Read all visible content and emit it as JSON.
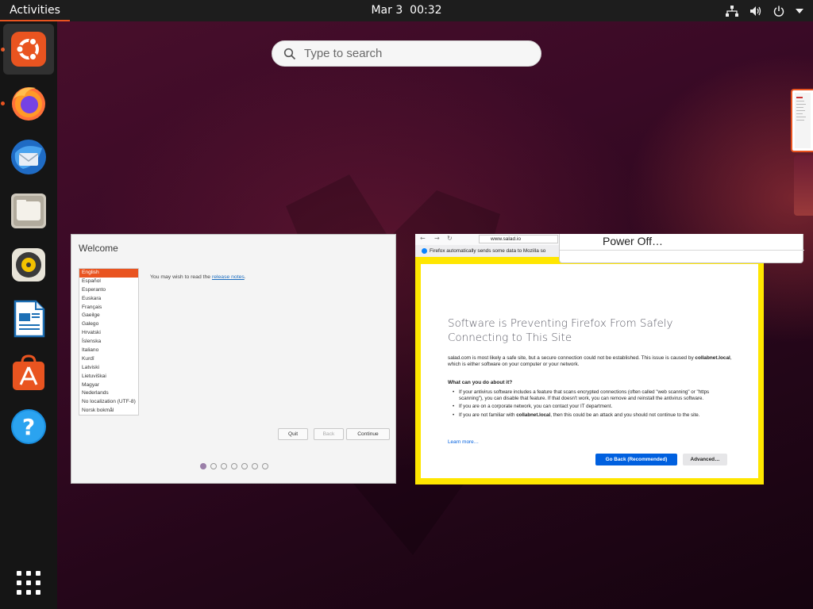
{
  "topbar": {
    "activities": "Activities",
    "date": "Mar 3",
    "time": "00:32"
  },
  "dock": {
    "items": [
      {
        "name": "ubuntu-installer",
        "icon": "ubuntu-logo-icon",
        "active": true
      },
      {
        "name": "firefox",
        "icon": "firefox-icon",
        "running": true
      },
      {
        "name": "thunderbird",
        "icon": "thunderbird-icon"
      },
      {
        "name": "files",
        "icon": "files-icon"
      },
      {
        "name": "rhythmbox",
        "icon": "rhythmbox-icon"
      },
      {
        "name": "libreoffice-writer",
        "icon": "writer-icon"
      },
      {
        "name": "ubuntu-software",
        "icon": "software-icon"
      },
      {
        "name": "help",
        "icon": "help-icon"
      }
    ],
    "show_apps_icon": "app-grid-icon"
  },
  "search": {
    "placeholder": "Type to search"
  },
  "installer": {
    "title": "Welcome",
    "languages": [
      "English",
      "Español",
      "Esperanto",
      "Euskara",
      "Français",
      "Gaeilge",
      "Galego",
      "Hrvatski",
      "Íslenska",
      "Italiano",
      "Kurdî",
      "Latviski",
      "Lietuviškai",
      "Magyar",
      "Nederlands",
      "No localization (UTF-8)",
      "Norsk bokmål"
    ],
    "selected_language": "English",
    "release_text": "You may wish to read the ",
    "release_link": "release notes",
    "release_end": ".",
    "buttons": {
      "quit": "Quit",
      "back": "Back",
      "continue": "Continue"
    },
    "progress": {
      "current": 1,
      "total": 7
    }
  },
  "firefox": {
    "url": "www.salad.io",
    "notice": "Firefox automatically sends some data to Mozilla so",
    "error_title": "Software is Preventing Firefox From Safely Connecting to This Site",
    "body_prefix": "salad.com is most likely a safe site, but a secure connection could not be established. This issue is caused by ",
    "body_host": "collabnet.local",
    "body_suffix": ", which is either software on your computer or your network.",
    "what_heading": "What can you do about it?",
    "bullets": [
      "If your antivirus software includes a feature that scans encrypted connections (often called \"web scanning\" or \"https scanning\"), you can disable that feature. If that doesn't work, you can remove and reinstall the antivirus software.",
      "If you are on a corporate network, you can contact your IT department."
    ],
    "bullet3_prefix": "If you are not familiar with ",
    "bullet3_host": "collabnet.local",
    "bullet3_suffix": ", then this could be an attack and you should not continue to the site.",
    "learn_more": "Learn more…",
    "go_back": "Go Back (Recommended)",
    "advanced": "Advanced…"
  },
  "power_menu": {
    "item": "Power Off…"
  },
  "colors": {
    "accent": "#e95420",
    "topbar": "#1d1d1d",
    "highlight_border": "#ffe600",
    "ff_primary": "#0060df"
  }
}
